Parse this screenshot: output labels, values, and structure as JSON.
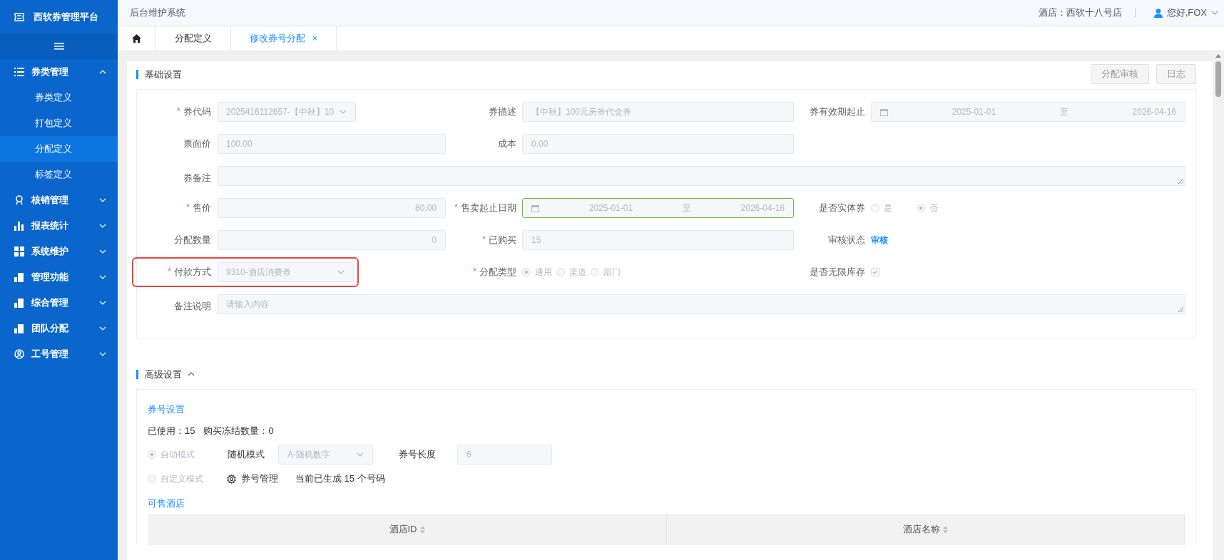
{
  "sidebar": {
    "title": "西软券管理平台",
    "items": [
      {
        "label": "券类管理",
        "expanded": true,
        "selected": false,
        "children": [
          {
            "label": "券类定义",
            "selected": false
          },
          {
            "label": "打包定义",
            "selected": false
          },
          {
            "label": "分配定义",
            "selected": true
          },
          {
            "label": "标签定义",
            "selected": false
          }
        ]
      },
      {
        "label": "核销管理",
        "expanded": false,
        "selected": false
      },
      {
        "label": "报表统计",
        "expanded": false,
        "selected": false
      },
      {
        "label": "系统维护",
        "expanded": false,
        "selected": false
      },
      {
        "label": "管理功能",
        "expanded": false,
        "selected": false
      },
      {
        "label": "综合管理",
        "expanded": false,
        "selected": false
      },
      {
        "label": "团队分配",
        "expanded": false,
        "selected": false
      },
      {
        "label": "工号管理",
        "expanded": false,
        "selected": false
      }
    ]
  },
  "header": {
    "title": "后台维护系统",
    "hotel": "酒店：西软十八号店",
    "user": "您好,FOX"
  },
  "tabs": [
    {
      "label": "分配定义",
      "selected": false
    },
    {
      "label": "修改券号分配",
      "selected": true,
      "close": "×"
    }
  ],
  "basic": {
    "title": "基础设置",
    "buttons": [
      "分配审核",
      "日志"
    ],
    "rows": [
      [
        {
          "kind": "select",
          "mark": "*",
          "label": "券代码",
          "value": "2025416112657-【中秋】10",
          "highlighted": false
        },
        {
          "kind": "input",
          "label": "券描述",
          "value": "【中秋】100元房券代金券",
          "highlighted": false
        },
        {
          "kind": "daterange",
          "label": "券有效期起止",
          "start": "2025-01-01",
          "separator": "至",
          "end": "2026-04-16",
          "focused": false,
          "highlighted": false
        }
      ],
      [
        {
          "kind": "input",
          "label": "票面价",
          "value": "100.00",
          "highlighted": false
        },
        {
          "kind": "input",
          "label": "成本",
          "value": "0.00",
          "highlighted": false
        }
      ],
      [
        {
          "kind": "textarea",
          "label": "券备注",
          "highlighted": false
        }
      ],
      [
        {
          "kind": "number",
          "mark": "*",
          "label": "售价",
          "value": "80.00",
          "highlighted": false
        },
        {
          "kind": "daterange",
          "mark": "*",
          "label": "售卖起止日期",
          "start": "2025-01-01",
          "separator": "至",
          "end": "2026-04-16",
          "focused": true,
          "highlighted": false
        },
        {
          "kind": "radios",
          "label": "是否实体券",
          "options": [
            {
              "label": "是",
              "selected": false
            },
            {
              "label": "否",
              "selected": true
            }
          ],
          "highlighted": false
        }
      ],
      [
        {
          "kind": "number",
          "label": "分配数量",
          "value": "0",
          "highlighted": false
        },
        {
          "kind": "input",
          "mark": "*",
          "label": "已购买",
          "value": "15",
          "highlighted": false
        },
        {
          "kind": "link",
          "label": "审核状态",
          "value": "审核",
          "highlighted": false
        }
      ],
      [
        {
          "kind": "select",
          "mark": "*",
          "label": "付款方式",
          "value": "9310-酒店消费券",
          "highlighted": true
        },
        {
          "kind": "radios",
          "mark": "*",
          "label": "分配类型",
          "options": [
            {
              "label": "通用",
              "selected": true
            },
            {
              "label": "渠道",
              "selected": false
            },
            {
              "label": "部门",
              "selected": false
            }
          ],
          "highlighted": false
        },
        {
          "kind": "checkbox",
          "label": "是否无限库存",
          "checked": true,
          "highlighted": false
        }
      ],
      [
        {
          "kind": "textarea",
          "label": "备注说明",
          "placeholder": "请输入内容",
          "highlighted": false
        }
      ]
    ]
  },
  "advanced": {
    "title": "高级设置",
    "expanded": true,
    "subtitle": "券号设置",
    "stats": [
      "已使用：15",
      "购买冻结数量：0"
    ],
    "modes": [
      {
        "label": "自动模式",
        "selected": true
      },
      {
        "label": "自定义模式",
        "selected": false
      }
    ],
    "random_mode": {
      "label": "随机模式",
      "value": "A-随机数字"
    },
    "code_length": {
      "label": "券号长度",
      "value": "6"
    },
    "manage_button": "券号管理",
    "generated": "当前已生成 15 个号码",
    "hotels": {
      "title": "可售酒店",
      "columns": [
        "酒店ID",
        "酒店名称"
      ]
    }
  }
}
